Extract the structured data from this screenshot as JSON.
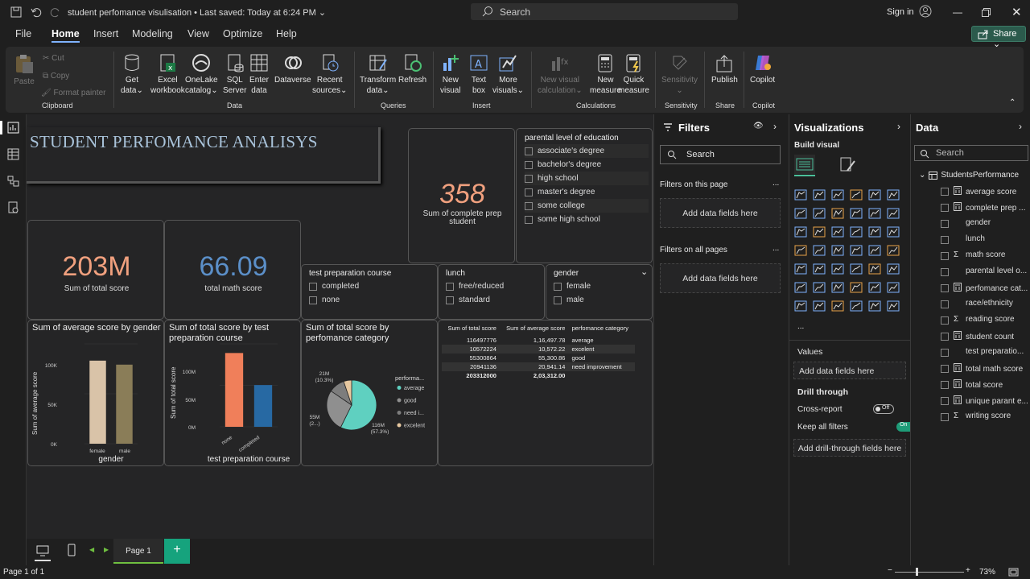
{
  "titlebar": {
    "doc_title": "student perfomance visulisation",
    "saved": " • Last saved: Today at 6:24 PM",
    "search": "Search",
    "signin": "Sign in"
  },
  "menu": {
    "items": [
      "File",
      "Home",
      "Insert",
      "Modeling",
      "View",
      "Optimize",
      "Help"
    ],
    "share": "Share"
  },
  "ribbon": {
    "clipboard": {
      "paste": "Paste",
      "cut": "Cut",
      "copy": "Copy",
      "format_painter": "Format painter",
      "group": "Clipboard"
    },
    "data": {
      "get_data": [
        "Get",
        "data"
      ],
      "excel": [
        "Excel",
        "workbook"
      ],
      "onelake": [
        "OneLake",
        "catalog"
      ],
      "sql": [
        "SQL",
        "Server"
      ],
      "enter": [
        "Enter",
        "data"
      ],
      "dataverse": "Dataverse",
      "recent": [
        "Recent",
        "sources"
      ],
      "group": "Data"
    },
    "queries": {
      "transform": [
        "Transform",
        "data"
      ],
      "refresh": "Refresh",
      "group": "Queries"
    },
    "insert": {
      "new_visual": [
        "New",
        "visual"
      ],
      "text_box": [
        "Text",
        "box"
      ],
      "more": [
        "More",
        "visuals"
      ],
      "group": "Insert"
    },
    "calculations": {
      "new_visual_calc": [
        "New visual",
        "calculation"
      ],
      "new_measure": [
        "New",
        "measure"
      ],
      "quick_measure": [
        "Quick",
        "measure"
      ],
      "group": "Calculations"
    },
    "sensitivity": {
      "label": "Sensitivity",
      "group": "Sensitivity"
    },
    "share": {
      "publish": "Publish",
      "group": "Share"
    },
    "copilot": {
      "label": "Copilot",
      "group": "Copilot"
    }
  },
  "report": {
    "title": "STUDENT PERFOMANCE ANALISYS",
    "kpi1": {
      "value": "358",
      "label": "Sum of complete prep student"
    },
    "kpi2": {
      "value": "203M",
      "label": "Sum of total score"
    },
    "kpi3": {
      "value": "66.09",
      "label": "total math score"
    },
    "slicer_parent": {
      "header": "parental level of education",
      "items": [
        "associate's degree",
        "bachelor's degree",
        "high school",
        "master's degree",
        "some college",
        "some high school"
      ]
    },
    "slicer_prep": {
      "header": "test preparation course",
      "items": [
        "completed",
        "none"
      ]
    },
    "slicer_lunch": {
      "header": "lunch",
      "items": [
        "free/reduced",
        "standard"
      ]
    },
    "slicer_gender": {
      "header": "gender",
      "items": [
        "female",
        "male"
      ]
    },
    "chart1": {
      "title": "Sum of average score by gender",
      "ylabel": "Sum of average score",
      "xlabel": "gender",
      "yticks": [
        "100K",
        "50K",
        "0K"
      ],
      "categories": [
        "female",
        "male"
      ]
    },
    "chart2": {
      "title": "Sum of total score by test preparation course",
      "ylabel": "Sum of total score",
      "xlabel": "test preparation course",
      "yticks": [
        "100M",
        "50M",
        "0M"
      ],
      "categories": [
        "none",
        "completed"
      ]
    },
    "chart3": {
      "title": "Sum of total score by perfomance category",
      "legend_title": "performa...",
      "legend": [
        "average",
        "good",
        "need i...",
        "excelent"
      ],
      "labels": {
        "a": "21M",
        "a2": "(10.3%)",
        "b": "55M",
        "b2": "(2...)",
        "c": "116M",
        "c2": "(57.3%)"
      }
    },
    "table": {
      "headers": [
        "Sum of total score",
        "Sum of average score",
        "perfomance category"
      ],
      "rows": [
        [
          "116497776",
          "1,16,497.78",
          "average"
        ],
        [
          "10572224",
          "10,572.22",
          "excelent"
        ],
        [
          "55300864",
          "55,300.86",
          "good"
        ],
        [
          "20941136",
          "20,941.14",
          "need improvement"
        ]
      ],
      "total": [
        "203312000",
        "2,03,312.00",
        ""
      ]
    }
  },
  "pagebar": {
    "page": "Page 1",
    "add": "+"
  },
  "status": {
    "page": "Page 1 of 1",
    "zoom": "73%"
  },
  "filters": {
    "title": "Filters",
    "search": "Search",
    "this_page": "Filters on this page",
    "all_pages": "Filters on all pages",
    "add": "Add data fields here",
    "more": "..."
  },
  "viz": {
    "title": "Visualizations",
    "build": "Build visual",
    "values": "Values",
    "add_values": "Add data fields here",
    "drill": "Drill through",
    "cross": "Cross-report",
    "cross_state": "Off",
    "keep": "Keep all filters",
    "keep_state": "On",
    "add_drill": "Add drill-through fields here",
    "more": "..."
  },
  "data": {
    "title": "Data",
    "search": "Search",
    "table": "StudentsPerformance",
    "fields": [
      {
        "name": "average score",
        "icon": "calc"
      },
      {
        "name": "complete prep ...",
        "icon": "calc"
      },
      {
        "name": "gender",
        "icon": ""
      },
      {
        "name": "lunch",
        "icon": ""
      },
      {
        "name": "math score",
        "icon": "sigma"
      },
      {
        "name": "parental level o...",
        "icon": ""
      },
      {
        "name": "perfomance cat...",
        "icon": "calc"
      },
      {
        "name": "race/ethnicity",
        "icon": ""
      },
      {
        "name": "reading score",
        "icon": "sigma"
      },
      {
        "name": "student count",
        "icon": "calc"
      },
      {
        "name": "test preparatio...",
        "icon": ""
      },
      {
        "name": "total math score",
        "icon": "calc"
      },
      {
        "name": "total score",
        "icon": "calc"
      },
      {
        "name": "unique parant e...",
        "icon": "calc"
      },
      {
        "name": "writing score",
        "icon": "sigma"
      }
    ]
  },
  "chart_data": [
    {
      "type": "bar",
      "title": "Sum of average score by gender",
      "xlabel": "gender",
      "ylabel": "Sum of average score",
      "categories": [
        "female",
        "male"
      ],
      "values": [
        104000,
        99000
      ],
      "ylim": [
        0,
        125000
      ],
      "colors": [
        "#d9c3a8",
        "#8a7d58"
      ]
    },
    {
      "type": "bar",
      "title": "Sum of total score by test preparation course",
      "xlabel": "test preparation course",
      "ylabel": "Sum of total score",
      "categories": [
        "none",
        "completed"
      ],
      "values": [
        129000000,
        73000000
      ],
      "ylim": [
        0,
        145000000
      ],
      "colors": [
        "#f07f5a",
        "#2769a3"
      ]
    },
    {
      "type": "pie",
      "title": "Sum of total score by perfomance category",
      "categories": [
        "average",
        "good",
        "need improvement",
        "excelent"
      ],
      "values": [
        116497776,
        55300864,
        20941136,
        10572224
      ],
      "colors": [
        "#5fd0c0",
        "#8f8f8f",
        "#7d7d7d",
        "#e7c8a0"
      ]
    }
  ]
}
